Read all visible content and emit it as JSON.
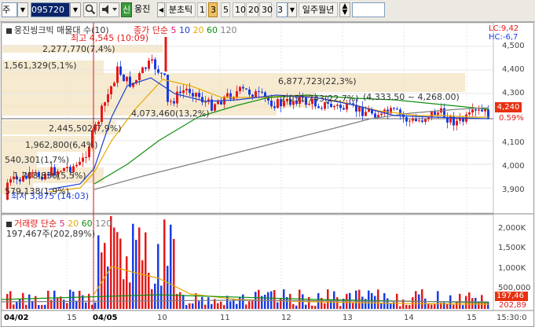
{
  "toolbar": {
    "market": "주",
    "code": "095720",
    "credit_badge": "신",
    "stock_name": "웅진",
    "period_label": "분초틱",
    "periods": [
      "1",
      "3",
      "5",
      "10",
      "20",
      "30"
    ],
    "active_period": "3",
    "count_value": "3",
    "day_week_month": "일주월년"
  },
  "chart": {
    "title": "웅진씽크빅 매물대 수(10)",
    "ma_header": "종가 단순",
    "ma_periods": [
      {
        "label": "5",
        "color": "#e0187c"
      },
      {
        "label": "10",
        "color": "#1d3fd0"
      },
      {
        "label": "20",
        "color": "#e8a800"
      },
      {
        "label": "60",
        "color": "#109010"
      },
      {
        "label": "120",
        "color": "#808080"
      }
    ],
    "high_label": "최고 4,545 (10:09)",
    "low_label": "최저 3,875 (14:03)",
    "range_label": "(4,333.50 ~ 4,268.00)",
    "lc": "LC:9,42",
    "hc": "HC:-6,7",
    "price_axis": [
      "4,500",
      "4,400",
      "4,300",
      "4,240",
      "4,200",
      "4,100",
      "4,000",
      "3,900"
    ],
    "current_price": "4,240",
    "current_pct": "0.59%",
    "volume_profile": [
      "2,277,770(7,4%)",
      "1,561,329(5,1%)",
      "6,877,723(22,3%)",
      "4,073,460(13,2%)",
      "7,051,743(22,7%)",
      "2,445,502(7,9%)",
      "1,962,800(6,4%)",
      "540,301(1,7%)",
      "1,708,836(5,5%)",
      "579,138(1,9%)"
    ]
  },
  "volume": {
    "title": "거래량",
    "ma_header": "단순",
    "ma_periods": [
      {
        "label": "5",
        "color": "#e0187c"
      },
      {
        "label": "20",
        "color": "#e8a800"
      },
      {
        "label": "60",
        "color": "#109010"
      },
      {
        "label": "120",
        "color": "#808080"
      }
    ],
    "current_label": "197,467주(202,89%)",
    "axis": [
      "2,000K",
      "1,500K",
      "1,000K",
      "500,000"
    ],
    "current_value": "197,46",
    "current_pct": "202,89"
  },
  "xaxis": {
    "labels": [
      "04/02",
      "15",
      "04/05",
      "10",
      "11",
      "12",
      "13",
      "14",
      "15",
      "15:30:0"
    ]
  },
  "colors": {
    "up": "#e41a1a",
    "down": "#1a3ce4",
    "profile_fill": "#f5e6c8",
    "current_price_badge": "#e83010"
  }
}
